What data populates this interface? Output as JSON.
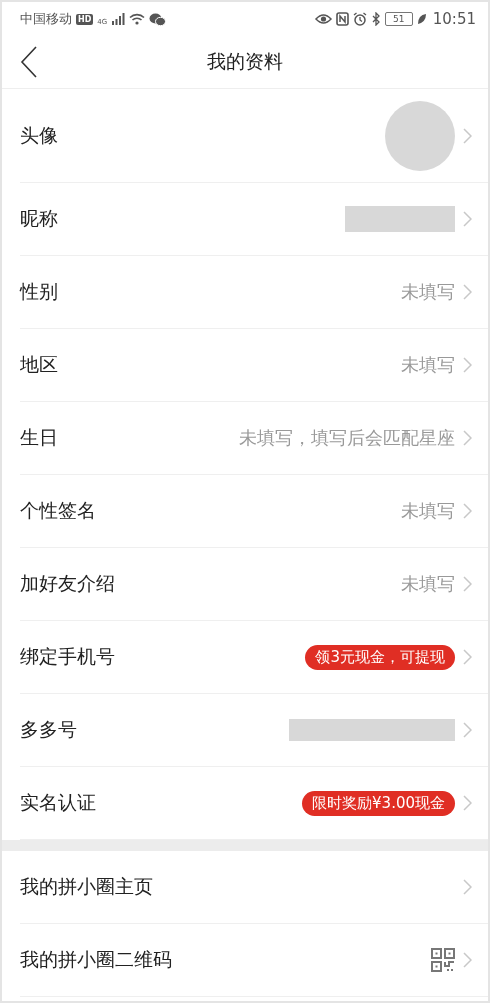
{
  "status_bar": {
    "carrier": "中国移动",
    "hd": "HD",
    "network": "4G",
    "battery": "51",
    "time": "10:51"
  },
  "header": {
    "title": "我的资料"
  },
  "sections": [
    {
      "rows": [
        {
          "label": "头像",
          "kind": "avatar"
        },
        {
          "label": "昵称",
          "kind": "redacted"
        },
        {
          "label": "性别",
          "kind": "text",
          "value": "未填写"
        },
        {
          "label": "地区",
          "kind": "text",
          "value": "未填写"
        },
        {
          "label": "生日",
          "kind": "text",
          "value": "未填写，填写后会匹配星座"
        },
        {
          "label": "个性签名",
          "kind": "text",
          "value": "未填写"
        },
        {
          "label": "加好友介绍",
          "kind": "text",
          "value": "未填写"
        },
        {
          "label": "绑定手机号",
          "kind": "badge",
          "value": "领3元现金，可提现"
        },
        {
          "label": "多多号",
          "kind": "redacted",
          "wide": true
        },
        {
          "label": "实名认证",
          "kind": "badge",
          "value": "限时奖励¥3.00现金"
        }
      ]
    },
    {
      "rows": [
        {
          "label": "我的拼小圈主页",
          "kind": "none"
        },
        {
          "label": "我的拼小圈二维码",
          "kind": "qr"
        }
      ]
    }
  ]
}
